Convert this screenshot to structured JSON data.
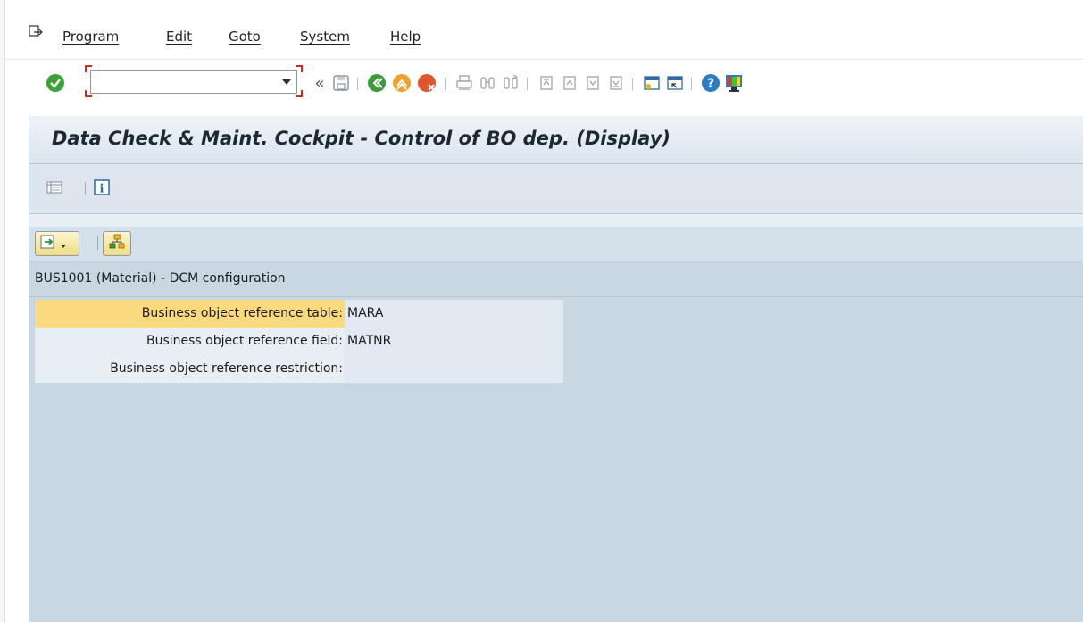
{
  "menubar": {
    "icon": "menu-exit-icon",
    "items": [
      {
        "label": "Program"
      },
      {
        "label": "Edit"
      },
      {
        "label": "Goto"
      },
      {
        "label": "System"
      },
      {
        "label": "Help"
      }
    ]
  },
  "toolbar": {
    "command_field": {
      "value": "",
      "placeholder": ""
    },
    "icons": [
      "enter-icon",
      "collapse-icon",
      "save-icon",
      "back-icon",
      "exit-icon",
      "cancel-icon",
      "print-icon",
      "find-icon",
      "find-next-icon",
      "first-page-icon",
      "previous-page-icon",
      "next-page-icon",
      "last-page-icon",
      "create-session-icon",
      "shortcut-icon",
      "help-icon",
      "customize-layout-icon"
    ],
    "colors": {
      "enter": "#3aa136",
      "back": "#3b9a3a",
      "exit": "#f0a02c",
      "cancel": "#e0552b"
    }
  },
  "window": {
    "title": "Data Check & Maint. Cockpit - Control of BO dep. (Display)"
  },
  "app_toolbar": {
    "icons": [
      "layout-list-icon",
      "info-icon"
    ]
  },
  "content": {
    "toolbar_icons": [
      "export-dropdown-icon",
      "object-hierarchy-icon"
    ],
    "section_title": "BUS1001 (Material) - DCM configuration",
    "fields": [
      {
        "label": "Business object reference table:",
        "value": "MARA"
      },
      {
        "label": "Business object reference field:",
        "value": "MATNR"
      },
      {
        "label": "Business object reference restriction:",
        "value": ""
      }
    ]
  },
  "colors": {
    "window_bg": "#c9d7e3",
    "highlight_label": "#fbd97e",
    "command_corner": "#d6281b"
  }
}
